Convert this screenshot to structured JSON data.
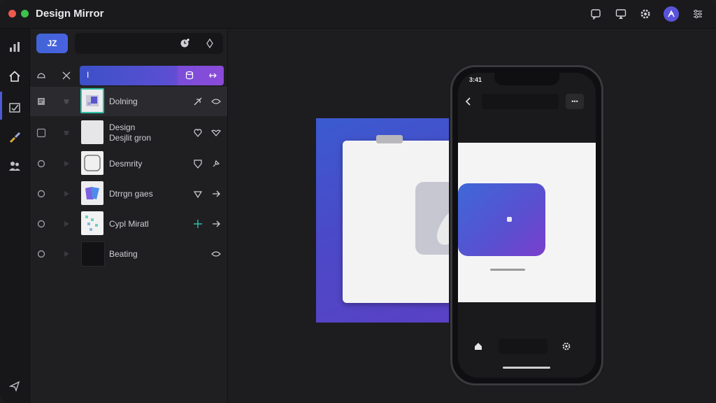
{
  "app": {
    "title": "Design Mirror",
    "colors": {
      "accent": "#4a62e0",
      "gradient_start": "#3c50c8",
      "gradient_end": "#8a44d6",
      "avatar": "#5a53d9"
    }
  },
  "titlebar_icons": [
    "chat-icon",
    "device-mirror-icon",
    "settings-icon",
    "profile-icon",
    "sliders-icon"
  ],
  "rail": {
    "items": [
      {
        "icon": "chart-icon"
      },
      {
        "icon": "home-icon",
        "active": true
      },
      {
        "icon": "image-check-icon"
      },
      {
        "icon": "brush-icon"
      },
      {
        "icon": "people-icon"
      },
      {
        "icon": "send-icon"
      }
    ]
  },
  "panel": {
    "top_button_label": "JZ",
    "toolbar_label": "I",
    "layers": [
      {
        "label": "Dolning",
        "selected": true
      },
      {
        "label": "Design\nDesjlit gron"
      },
      {
        "label": "Desmrity"
      },
      {
        "label": "Dtrrgn gaes"
      },
      {
        "label": "Cypl Miratl"
      },
      {
        "label": "Beating"
      }
    ]
  },
  "phone": {
    "time": "3:41",
    "more_label": "•••"
  }
}
